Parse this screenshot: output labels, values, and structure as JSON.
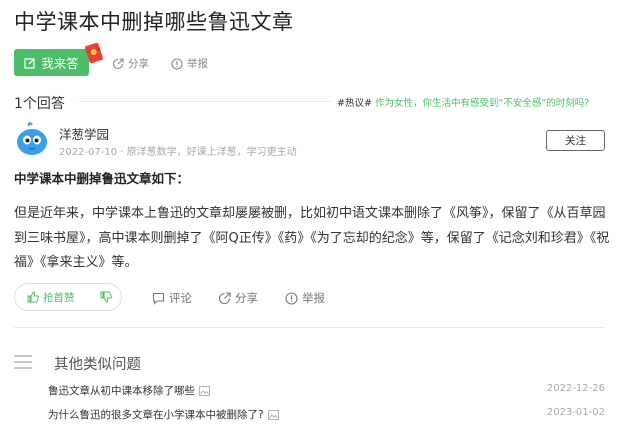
{
  "question": {
    "title": "中学课本中删掉哪些鲁迅文章",
    "answer_button": "我来答",
    "share": "分享",
    "report": "举报"
  },
  "answers_bar": {
    "count": "1个回答",
    "hot_tag": "#热议#",
    "hot_link": "作为女性，你生活中有感受到“不安全感”的时刻吗?"
  },
  "answer": {
    "author": "洋葱学园",
    "meta": "2022-07-10 · 原洋葱数学，好课上洋葱，学习更主动",
    "follow": "关注",
    "heading": "中学课本中删掉鲁迅文章如下：",
    "body": "但是近年来，中学课本上鲁迅的文章却屡屡被删，比如初中语文课本删除了《风筝》，保留了《从百草园到三味书屋》，高中课本则删掉了《阿Q正传》《药》《为了忘却的纪念》等，保留了《记念刘和珍君》《祝福》《拿来主义》等。",
    "like": "抢首赞",
    "comment": "评论",
    "share": "分享",
    "report": "举报"
  },
  "similar": {
    "title": "其他类似问题",
    "items": [
      {
        "text": "鲁迅文章从初中课本移除了哪些",
        "date": "2022-12-26"
      },
      {
        "text": "为什么鲁迅的很多文章在小学课本中被删除了?",
        "date": "2023-01-02"
      }
    ]
  },
  "colors": {
    "accent": "#4cbd68",
    "avatar_blue": "#3aa1e8"
  },
  "icons": [
    "edit-icon",
    "red-packet-icon",
    "share-icon",
    "report-icon",
    "thumbs-up-icon",
    "thumbs-down-icon",
    "comment-icon",
    "list-icon",
    "image-icon"
  ]
}
